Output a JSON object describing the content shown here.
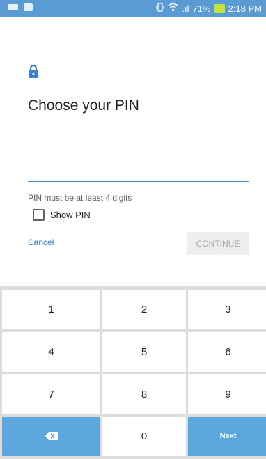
{
  "status_bar": {
    "signal_text": ".ıl",
    "battery_percent": "71%",
    "time": "2:18 PM",
    "icons": [
      "notification-icon",
      "image-icon",
      "vibrate-icon",
      "wifi-icon",
      "signal-icon",
      "battery-charging-icon"
    ]
  },
  "header": {
    "title": "Choose your PIN",
    "icon": "lock-icon"
  },
  "pin_field": {
    "value": ""
  },
  "hint": "PIN must be at least 4 digits",
  "show_pin": {
    "label": "Show PIN",
    "checked": false
  },
  "actions": {
    "cancel": "Cancel",
    "continue": "CONTINUE"
  },
  "keypad": {
    "keys": [
      "1",
      "2",
      "3",
      "4",
      "5",
      "6",
      "7",
      "8",
      "9"
    ],
    "zero": "0",
    "next": "Next",
    "backspace_icon": "backspace-icon"
  },
  "colors": {
    "status_bar": "#5a9bd4",
    "accent": "#4a90d9",
    "keypad_action": "#5aa8dd",
    "keypad_bg": "#dcdcdc"
  }
}
